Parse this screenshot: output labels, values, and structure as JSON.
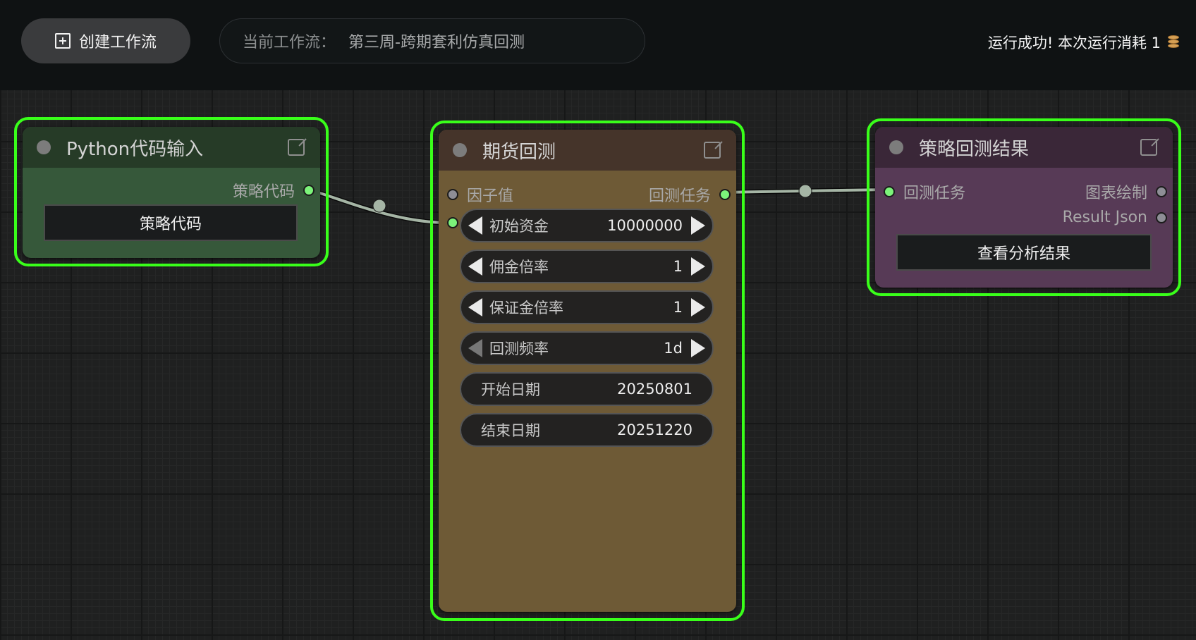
{
  "topbar": {
    "create_label": "创建工作流",
    "workflow_label": "当前工作流：",
    "workflow_name": "第三周-跨期套利仿真回测",
    "status_text": "运行成功!  本次运行消耗 1"
  },
  "nodes": {
    "python": {
      "title": "Python代码输入",
      "output_slot": "策略代码",
      "button": "策略代码"
    },
    "backtest": {
      "title": "期货回测",
      "input_slot": "因子值",
      "output_slot": "回测任务",
      "widgets": [
        {
          "label": "初始资金",
          "value": "10000000"
        },
        {
          "label": "佣金倍率",
          "value": "1"
        },
        {
          "label": "保证金倍率",
          "value": "1"
        },
        {
          "label": "回测频率",
          "value": "1d"
        },
        {
          "label": "开始日期",
          "value": "20250801"
        },
        {
          "label": "结束日期",
          "value": "20251220"
        }
      ]
    },
    "result": {
      "title": "策略回测结果",
      "input_slot": "回测任务",
      "output_slots": [
        "图表绘制",
        "Result Json"
      ],
      "button": "查看分析结果"
    }
  },
  "colors": {
    "selection_outline": "#39ff1a",
    "python_header": "#263b27",
    "python_body": "#36583a",
    "backtest_header": "#45342a",
    "backtest_body": "#6e5a36",
    "result_header": "#3a2738",
    "result_body": "#573a56"
  }
}
